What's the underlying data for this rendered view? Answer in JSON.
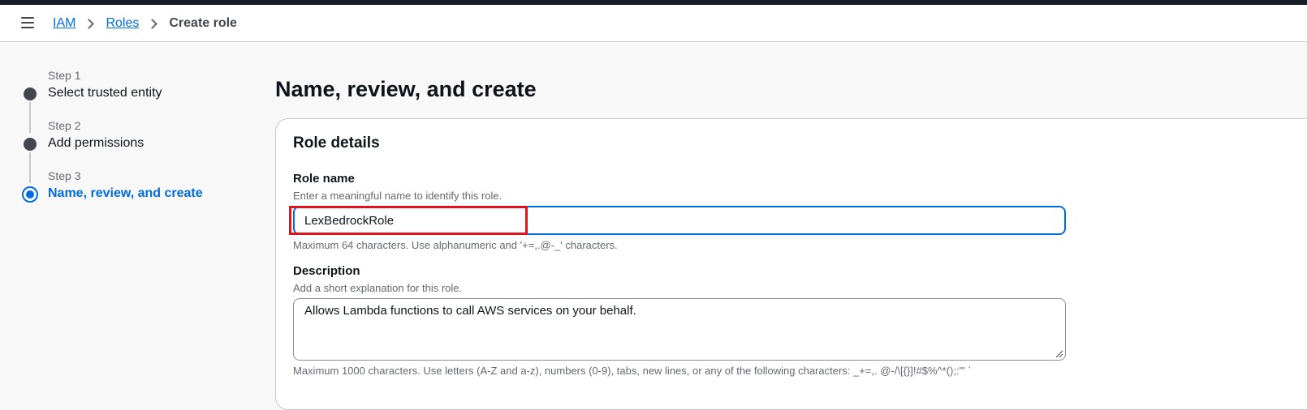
{
  "breadcrumb": {
    "items": [
      {
        "label": "IAM"
      },
      {
        "label": "Roles"
      }
    ],
    "current": "Create role"
  },
  "steps": [
    {
      "number": "Step 1",
      "label": "Select trusted entity"
    },
    {
      "number": "Step 2",
      "label": "Add permissions"
    },
    {
      "number": "Step 3",
      "label": "Name, review, and create"
    }
  ],
  "page": {
    "title": "Name, review, and create"
  },
  "role_details": {
    "heading": "Role details",
    "role_name": {
      "label": "Role name",
      "description": "Enter a meaningful name to identify this role.",
      "value": "LexBedrockRole",
      "constraint": "Maximum 64 characters. Use alphanumeric and '+=,.@-_' characters."
    },
    "description": {
      "label": "Description",
      "description": "Add a short explanation for this role.",
      "value": "Allows Lambda functions to call AWS services on your behalf.",
      "constraint": "Maximum 1000 characters. Use letters (A-Z and a-z), numbers (0-9), tabs, new lines, or any of the following characters: _+=,. @-/\\[{}]!#$%^*();:\"' `"
    }
  },
  "colors": {
    "accent": "#006ce0",
    "highlight": "#e1141b",
    "text": "#0f141a",
    "muted": "#656871"
  }
}
